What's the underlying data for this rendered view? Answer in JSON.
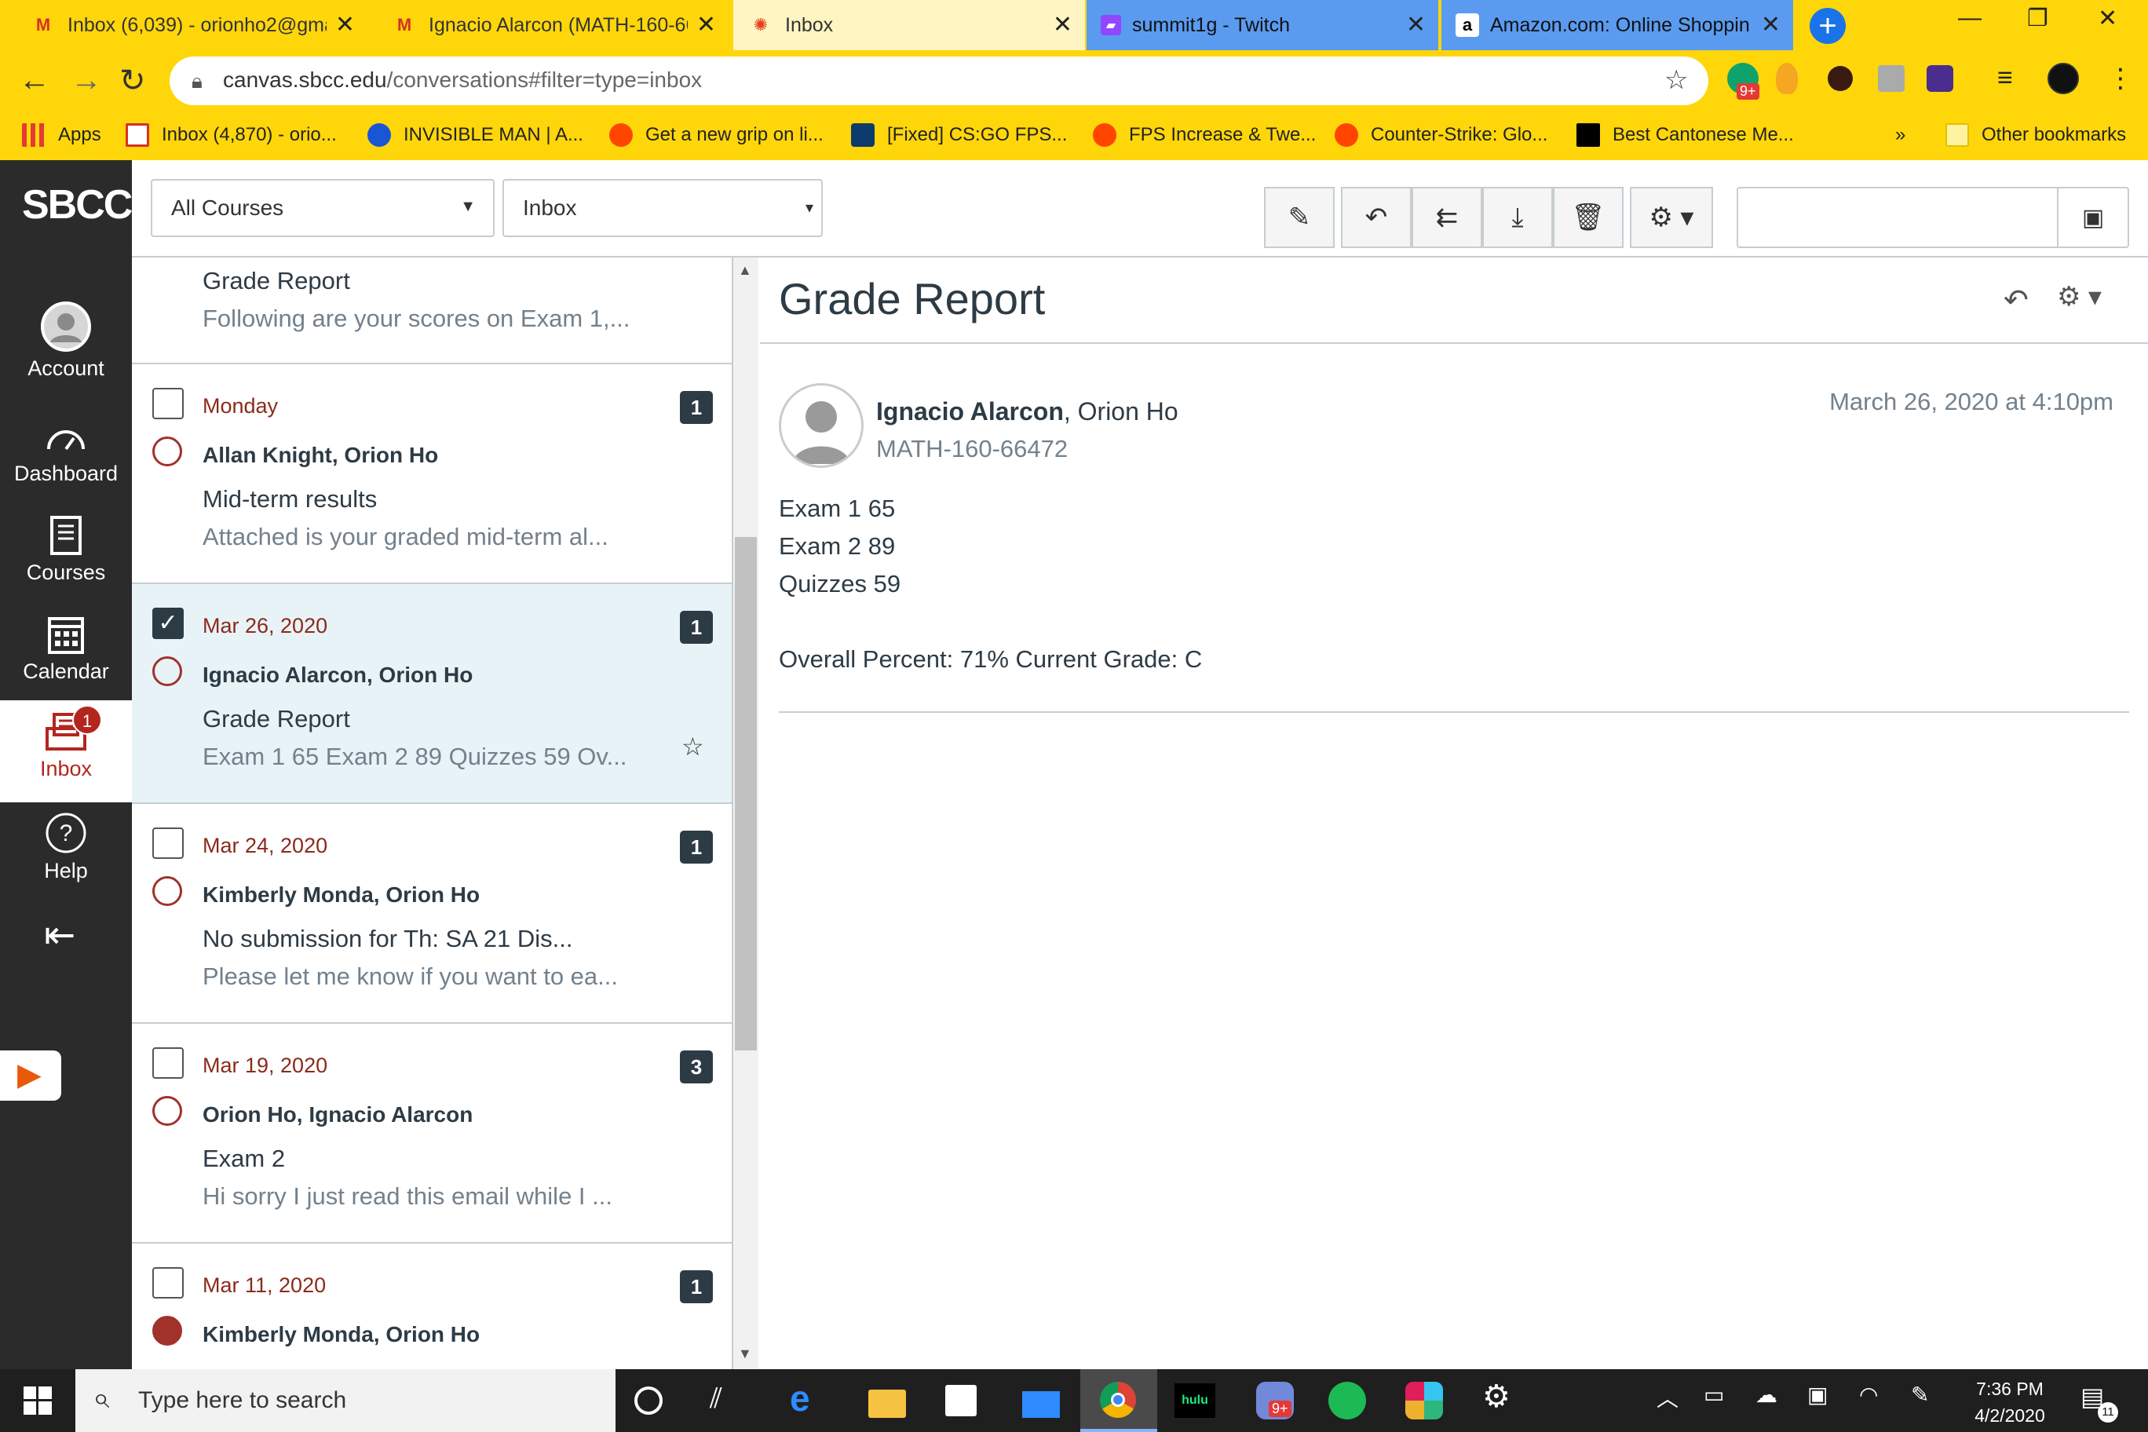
{
  "browser": {
    "tabs": [
      {
        "title": "Inbox (6,039) - orionho2@gma",
        "icon": "gmail-icon"
      },
      {
        "title": "Ignacio Alarcon (MATH-160-66",
        "icon": "gmail-icon"
      },
      {
        "title": "Inbox",
        "icon": "canvas-icon"
      },
      {
        "title": "summit1g - Twitch",
        "icon": "twitch-icon"
      },
      {
        "title": "Amazon.com: Online Shopping",
        "icon": "amazon-icon"
      }
    ],
    "url_host": "canvas.sbcc.edu",
    "url_path": "/conversations#filter=type=inbox",
    "bookmarks": [
      "Apps",
      "Inbox (4,870) - orio...",
      "INVISIBLE MAN | A...",
      "Get a new grip on li...",
      "[Fixed] CS:GO FPS...",
      "FPS Increase & Twe...",
      "Counter-Strike: Glo...",
      "Best Cantonese Me..."
    ],
    "bookmarks_overflow": "»",
    "other_bookmarks": "Other bookmarks",
    "extension_badge": "9+"
  },
  "sidenav": {
    "logo": "SBCC",
    "items": [
      {
        "label": "Account"
      },
      {
        "label": "Dashboard"
      },
      {
        "label": "Courses"
      },
      {
        "label": "Calendar"
      },
      {
        "label": "Inbox",
        "badge": "1"
      },
      {
        "label": "Help"
      }
    ]
  },
  "toolbar": {
    "course_filter": "All Courses",
    "type_filter": "Inbox"
  },
  "list": {
    "items": [
      {
        "date": "",
        "participants": "",
        "subject": "Grade Report",
        "preview": "Following are your scores on Exam 1,...",
        "count": "",
        "selected": false
      },
      {
        "date": "Monday",
        "participants": "Allan Knight, Orion Ho",
        "subject": "Mid-term results",
        "preview": "Attached is your graded mid-term al...",
        "count": "1",
        "selected": false
      },
      {
        "date": "Mar 26, 2020",
        "participants": "Ignacio Alarcon, Orion Ho",
        "subject": "Grade Report",
        "preview": "Exam 1 65 Exam 2 89 Quizzes 59 Ov...",
        "count": "1",
        "selected": true
      },
      {
        "date": "Mar 24, 2020",
        "participants": "Kimberly Monda, Orion Ho",
        "subject": "No submission for Th: SA 21 Dis...",
        "preview": "Please let me know if you want to ea...",
        "count": "1",
        "selected": false
      },
      {
        "date": "Mar 19, 2020",
        "participants": "Orion Ho, Ignacio Alarcon",
        "subject": "Exam 2",
        "preview": "Hi sorry I just read this email while I ...",
        "count": "3",
        "selected": false
      },
      {
        "date": "Mar 11, 2020",
        "participants": "Kimberly Monda, Orion Ho",
        "subject": "",
        "preview": "",
        "count": "1",
        "selected": false
      }
    ]
  },
  "detail": {
    "title": "Grade Report",
    "sender": "Ignacio Alarcon",
    "recipients": ", Orion Ho",
    "course": "MATH-160-66472",
    "timestamp": "March 26, 2020 at 4:10pm",
    "body_lines": [
      "Exam 1 65",
      "Exam 2 89",
      "Quizzes 59",
      "",
      "Overall Percent: 71% Current Grade: C"
    ]
  },
  "taskbar": {
    "search_placeholder": "Type here to search",
    "time": "7:36 PM",
    "date": "4/2/2020",
    "hulu_label": "hulu",
    "discord_badge": "9+",
    "notification_count": "11"
  }
}
